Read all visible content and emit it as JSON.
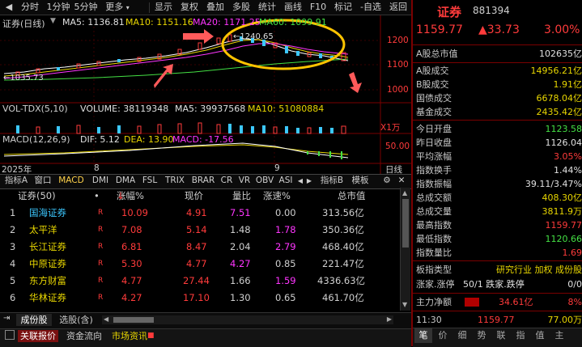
{
  "toolbar": {
    "left_icon": "back-arrow-icon",
    "items": [
      "分时",
      "1分钟",
      "5分钟",
      "更多"
    ],
    "right_items": [
      "显示",
      "复权",
      "叠加",
      "多股",
      "统计",
      "画线",
      "F10",
      "标记",
      "-自选",
      "返回"
    ]
  },
  "kline": {
    "title": "证券(日线)",
    "ma5_label": "MA5: 1136.81",
    "ma10_label": "MA10: 1151.16",
    "ma20_label": "MA20: 1171.25",
    "ma60_label": "MA60: 1099.91",
    "high_mark": "1240.65",
    "low_mark": "1035.73",
    "y_ticks": [
      "1200",
      "1100",
      "1000"
    ]
  },
  "volume": {
    "title": "VOL-TDX(5,10)",
    "vol_label": "VOLUME: 38119348",
    "ma5_label": "MA5: 39937568",
    "ma10_label": "MA10: 51080884",
    "unit": "X1万"
  },
  "macd": {
    "title": "MACD(12,26,9)",
    "dif_label": "DIF: 5.12",
    "dea_label": "DEA: 13.90",
    "macd_label": "MACD: -17.56",
    "y_tick": "50.00"
  },
  "date_axis": {
    "year": "2025年",
    "m1": "8",
    "m2": "9",
    "period": "日线"
  },
  "indicator_tabs": [
    "指标A",
    "窗口",
    "MACD",
    "DMI",
    "DMA",
    "FSL",
    "TRIX",
    "BRAR",
    "CR",
    "VR",
    "OBV",
    "ASI"
  ],
  "indicator_right": [
    "指标B",
    "模板"
  ],
  "table": {
    "headers": [
      "证券(50)",
      "•",
      "涨幅%",
      "现价",
      "量比",
      "涨速%",
      "总市值"
    ],
    "sort_marker": "↓",
    "rows": [
      {
        "idx": "1",
        "name": "国海证券",
        "flag": "R",
        "pct": "10.09",
        "price": "4.91",
        "vr": "7.51",
        "speed": "0.00",
        "cap": "313.56亿"
      },
      {
        "idx": "2",
        "name": "太平洋",
        "flag": "R",
        "pct": "7.08",
        "price": "5.14",
        "vr": "1.48",
        "speed": "1.78",
        "cap": "350.36亿"
      },
      {
        "idx": "3",
        "name": "长江证券",
        "flag": "R",
        "pct": "6.81",
        "price": "8.47",
        "vr": "2.04",
        "speed": "2.79",
        "cap": "468.40亿"
      },
      {
        "idx": "4",
        "name": "中原证券",
        "flag": "R",
        "pct": "5.30",
        "price": "4.77",
        "vr": "4.27",
        "speed": "0.85",
        "cap": "221.47亿"
      },
      {
        "idx": "5",
        "name": "东方财富",
        "flag": "R",
        "pct": "4.77",
        "price": "27.44",
        "vr": "1.66",
        "speed": "1.59",
        "cap": "4336.63亿"
      },
      {
        "idx": "6",
        "name": "华林证券",
        "flag": "R",
        "pct": "4.27",
        "price": "17.10",
        "vr": "1.30",
        "speed": "0.65",
        "cap": "461.70亿"
      }
    ]
  },
  "bottom_tabs": {
    "tab1": "成份股",
    "tab2": "选股(含)"
  },
  "footer": {
    "tab1": "关联报价",
    "tab2": "资金流向",
    "tab3": "市场资讯"
  },
  "right_panel": {
    "title": "证券",
    "code": "881394",
    "price": "1159.77",
    "change": "▲33.73",
    "pct": "3.00%",
    "block1": [
      {
        "label": "A股总市值",
        "value": "102635亿"
      }
    ],
    "block2": [
      {
        "label": "A股成交",
        "value": "14956.21亿"
      },
      {
        "label": "B股成交",
        "value": "1.91亿"
      },
      {
        "label": "国债成交",
        "value": "6678.04亿"
      },
      {
        "label": "基金成交",
        "value": "2435.42亿"
      }
    ],
    "block3": [
      {
        "label": "今日开盘",
        "value": "1123.58"
      },
      {
        "label": "昨日收盘",
        "value": "1126.04"
      },
      {
        "label": "平均涨幅",
        "value": "3.05%"
      },
      {
        "label": "指数换手",
        "value": "1.44%"
      },
      {
        "label": "指数振幅",
        "value": "39.11/3.47%"
      },
      {
        "label": "总成交额",
        "value": "408.30亿"
      },
      {
        "label": "总成交量",
        "value": "3811.9万"
      },
      {
        "label": "最高指数",
        "value": "1159.77"
      },
      {
        "label": "最低指数",
        "value": "1120.66"
      },
      {
        "label": "指数量比",
        "value": "1.69"
      }
    ],
    "sector_label": "板指类型",
    "sector_value": "研究行业 加权 成份股",
    "updown_label": "涨家.涨停",
    "updown_value": "50/1 跌家.跌停",
    "updown_value2": "0/0",
    "flow_label": "主力净额",
    "flow_value": "34.61亿",
    "flow_pct": "8%",
    "last_time": "11:30",
    "last_price": "1159.77",
    "last_amount": "77.00万",
    "bottom_icons": [
      "笔",
      "价",
      "细",
      "势",
      "联",
      "指",
      "值",
      "主"
    ]
  }
}
